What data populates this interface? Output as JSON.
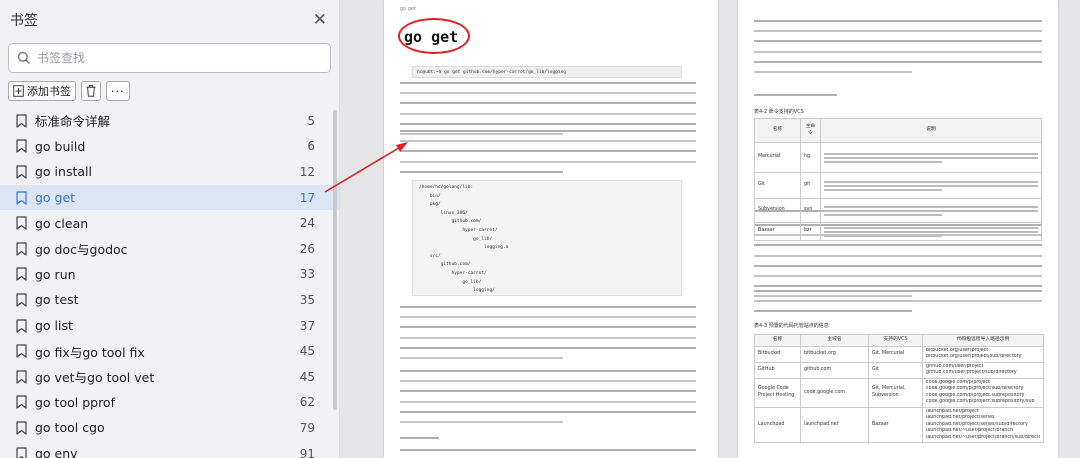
{
  "sidebar": {
    "title": "书签",
    "search_placeholder": "书签查找",
    "add_bookmark_label": "添加书签",
    "items": [
      {
        "name": "标准命令详解",
        "page": "5",
        "active": false
      },
      {
        "name": "go build",
        "page": "6",
        "active": false
      },
      {
        "name": "go install",
        "page": "12",
        "active": false
      },
      {
        "name": "go get",
        "page": "17",
        "active": true
      },
      {
        "name": "go clean",
        "page": "24",
        "active": false
      },
      {
        "name": "go doc与godoc",
        "page": "26",
        "active": false
      },
      {
        "name": "go run",
        "page": "33",
        "active": false
      },
      {
        "name": "go test",
        "page": "35",
        "active": false
      },
      {
        "name": "go list",
        "page": "37",
        "active": false
      },
      {
        "name": "go fix与go tool fix",
        "page": "45",
        "active": false
      },
      {
        "name": "go vet与go tool vet",
        "page": "45",
        "active": false
      },
      {
        "name": "go tool pprof",
        "page": "62",
        "active": false
      },
      {
        "name": "go tool cgo",
        "page": "79",
        "active": false
      },
      {
        "name": "go env",
        "page": "91",
        "active": false
      }
    ]
  },
  "page1": {
    "header": "go get",
    "chapter_title": "go get",
    "command_line": "hc@ubt:~$ go get github.com/hyper-carrot/go_lib/logging",
    "code_lines": [
      "/home/hc/golang/lib:",
      "    bin/",
      "    pkg/",
      "        linux_386/",
      "            github.com/",
      "                hyper-carrot/",
      "                    go_lib/",
      "                        logging.a",
      "    src/",
      "        github.com/",
      "            hyper-carrot/",
      "                go_lib/",
      "                    logging/"
    ]
  },
  "page2": {
    "table1_title": "表4-2    命令支持的VCS",
    "table1_headers": [
      "名称",
      "主命令",
      "说明"
    ],
    "table1_rows": [
      {
        "name": "Mercurial",
        "cmd": "hg"
      },
      {
        "name": "Git",
        "cmd": "git"
      },
      {
        "name": "Subversion",
        "cmd": "svn"
      },
      {
        "name": "Bazaar",
        "cmd": "bzr"
      }
    ],
    "table2_title": "表4-3    预置的代码托管站点的信息",
    "table2_headers": [
      "名称",
      "主域名",
      "支持的VCS",
      "代码包远程导入路径示例"
    ],
    "table2_rows": [
      {
        "name": "Bitbucket",
        "domain": "bitbucket.org",
        "vcs": "Git, Mercurial",
        "examples": [
          "bitbucket.org/user/project",
          "bitbucket.org/user/project/sub/directory"
        ]
      },
      {
        "name": "GitHub",
        "domain": "github.com",
        "vcs": "Git",
        "examples": [
          "github.com/user/project",
          "github.com/user/project/sub/directory"
        ]
      },
      {
        "name": "Google Code Project Hosting",
        "domain": "code.google.com",
        "vcs": "Git, Mercurial, Subversion",
        "examples": [
          "code.google.com/p/project",
          "code.google.com/p/project/sub/directory",
          "code.google.com/p/project.subrepository",
          "code.google.com/p/project.subrepository/sub"
        ]
      },
      {
        "name": "Launchpad",
        "domain": "launchpad.net",
        "vcs": "Bazaar",
        "examples": [
          "launchpad.net/project",
          "launchpad.net/project/series",
          "launchpad.net/project/series/sub/directory",
          "launchpad.net/~user/project/branch",
          "launchpad.net/~user/project/branch/sub/directory"
        ]
      }
    ]
  },
  "colors": {
    "accent": "#3a74d8",
    "active_item_bg": "#dbe5f3",
    "annotation": "#e02020"
  }
}
